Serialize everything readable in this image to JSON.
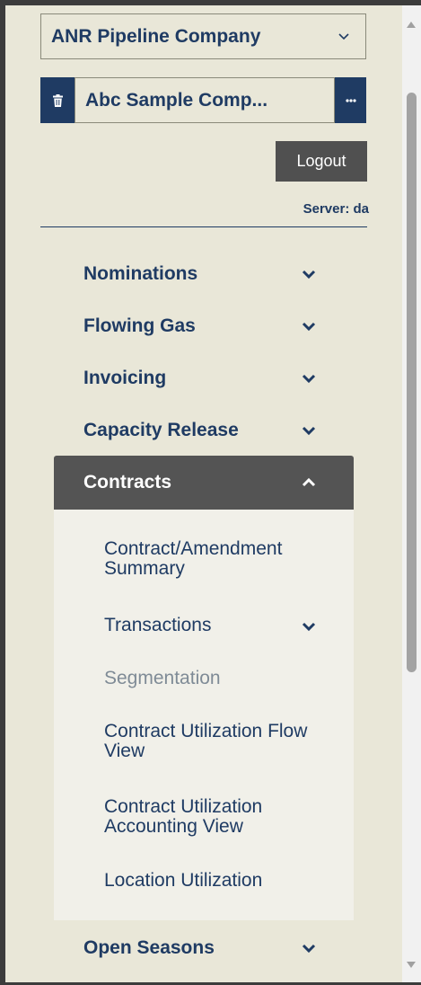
{
  "company_select": {
    "label": "ANR Pipeline Company"
  },
  "company": {
    "name": "Abc Sample Comp..."
  },
  "logout": {
    "label": "Logout"
  },
  "server": {
    "text": "Server: da"
  },
  "nav": {
    "nominations": "Nominations",
    "flowing_gas": "Flowing Gas",
    "invoicing": "Invoicing",
    "capacity_release": "Capacity Release",
    "contracts": "Contracts",
    "open_seasons": "Open Seasons"
  },
  "contracts_sub": {
    "summary": "Contract/Amendment Summary",
    "transactions": "Transactions",
    "segmentation": "Segmentation",
    "flow_view": "Contract Utilization Flow View",
    "accounting_view": "Contract Utilization Accounting View",
    "location_utilization": "Location Utilization"
  },
  "icons": {
    "company_caret": "chevron-down-icon",
    "trash": "trash-icon",
    "more": "ellipsis-icon",
    "expand": "chevron-down-icon",
    "collapse": "chevron-up-icon"
  },
  "colors": {
    "background": "#e9e7d8",
    "navy": "#1f3b63",
    "active_header": "#545454",
    "submenu_bg": "#f1f0e9",
    "muted_text": "#7f8b96"
  }
}
